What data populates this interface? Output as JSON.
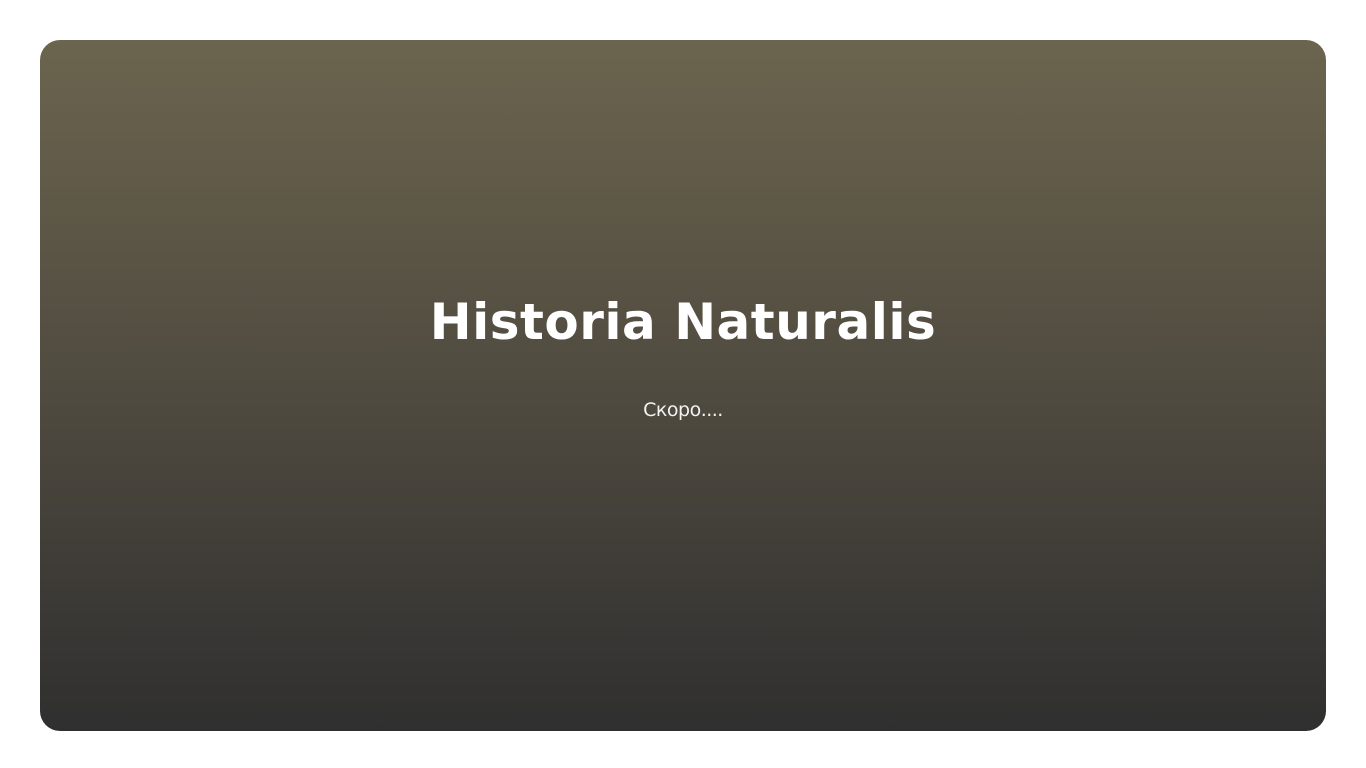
{
  "hero": {
    "title": "Historia Naturalis",
    "subtitle": "Скоро....",
    "gradient_top_color": "#6b644e",
    "gradient_bottom_color": "#2f2f2f",
    "text_color": "#ffffff"
  }
}
